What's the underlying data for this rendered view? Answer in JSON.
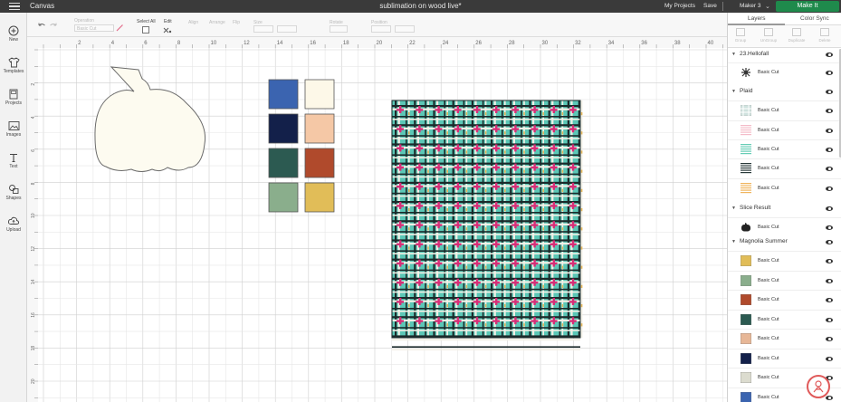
{
  "header": {
    "app_title": "Canvas",
    "document_title": "sublimation on wood live*",
    "my_projects": "My Projects",
    "save": "Save",
    "machine": "Maker 3",
    "make_it": "Make It"
  },
  "sidebar": {
    "items": [
      {
        "label": "New",
        "icon": "plus-icon"
      },
      {
        "label": "Templates",
        "icon": "shirt-icon"
      },
      {
        "label": "Projects",
        "icon": "projects-icon"
      },
      {
        "label": "Images",
        "icon": "image-icon"
      },
      {
        "label": "Text",
        "icon": "text-icon"
      },
      {
        "label": "Shapes",
        "icon": "shapes-icon"
      },
      {
        "label": "Upload",
        "icon": "cloud-upload-icon"
      }
    ]
  },
  "toolbar": {
    "select_all": "Select All",
    "edit": "Edit",
    "operation": "Operation",
    "basic_cut": "Basic Cut",
    "align": "Align",
    "arrange": "Arrange",
    "flip": "Flip",
    "size": "Size",
    "rotate": "Rotate",
    "position": "Position"
  },
  "ruler": {
    "top_labels": [
      "2",
      "4",
      "6",
      "8",
      "10",
      "12",
      "14",
      "16",
      "18",
      "20",
      "22",
      "24",
      "26",
      "28",
      "30",
      "32",
      "34",
      "36",
      "38",
      "40"
    ],
    "left_labels": [
      "2",
      "4",
      "6",
      "8",
      "10",
      "12",
      "14",
      "16",
      "18",
      "20"
    ]
  },
  "canvas": {
    "pumpkin_color": "#fdfbf0",
    "swatches": [
      "#3b64b0",
      "#fdf8e8",
      "#13204a",
      "#f5c8a6",
      "#2c5a51",
      "#b04a2c",
      "#8aae8c",
      "#e1bd58"
    ],
    "plaid": {
      "background": "#5bc7b6",
      "stripe_dark": "#1b2a2a",
      "stripe_light": "#f3f0e6",
      "accent": "#d62e77",
      "gold": "#e6b85c"
    }
  },
  "panel": {
    "tabs": [
      "Layers",
      "Color Sync"
    ],
    "actions": [
      "Group",
      "UnGroup",
      "Duplicate",
      "Delete"
    ],
    "groups": [
      {
        "name": "23.Hellofall",
        "layers": [
          {
            "label": "Basic Cut",
            "thumb": "#333333",
            "kind": "design"
          }
        ]
      },
      {
        "name": "Plaid",
        "layers": [
          {
            "label": "Basic Cut",
            "thumb": "#cfe2de",
            "kind": "plaid"
          },
          {
            "label": "Basic Cut",
            "thumb": "#f4bcc9",
            "kind": "stripes"
          },
          {
            "label": "Basic Cut",
            "thumb": "#67cdb6",
            "kind": "stripes"
          },
          {
            "label": "Basic Cut",
            "thumb": "#2a3a3a",
            "kind": "stripes"
          },
          {
            "label": "Basic Cut",
            "thumb": "#f0b55e",
            "kind": "stripes"
          }
        ]
      },
      {
        "name": "Slice Result",
        "layers": [
          {
            "label": "Basic Cut",
            "thumb": "#222222",
            "kind": "pumpkin"
          }
        ]
      },
      {
        "name": "Magnolia Summer",
        "layers": [
          {
            "label": "Basic Cut",
            "thumb": "#e1bd58",
            "kind": "square"
          },
          {
            "label": "Basic Cut",
            "thumb": "#8aae8c",
            "kind": "square"
          },
          {
            "label": "Basic Cut",
            "thumb": "#b04a2c",
            "kind": "square"
          },
          {
            "label": "Basic Cut",
            "thumb": "#2c5a51",
            "kind": "square"
          },
          {
            "label": "Basic Cut",
            "thumb": "#e7b797",
            "kind": "square"
          },
          {
            "label": "Basic Cut",
            "thumb": "#13204a",
            "kind": "square"
          },
          {
            "label": "Basic Cut",
            "thumb": "#dcdccf",
            "kind": "square"
          },
          {
            "label": "Basic Cut",
            "thumb": "#3b64b0",
            "kind": "square"
          }
        ]
      }
    ]
  }
}
